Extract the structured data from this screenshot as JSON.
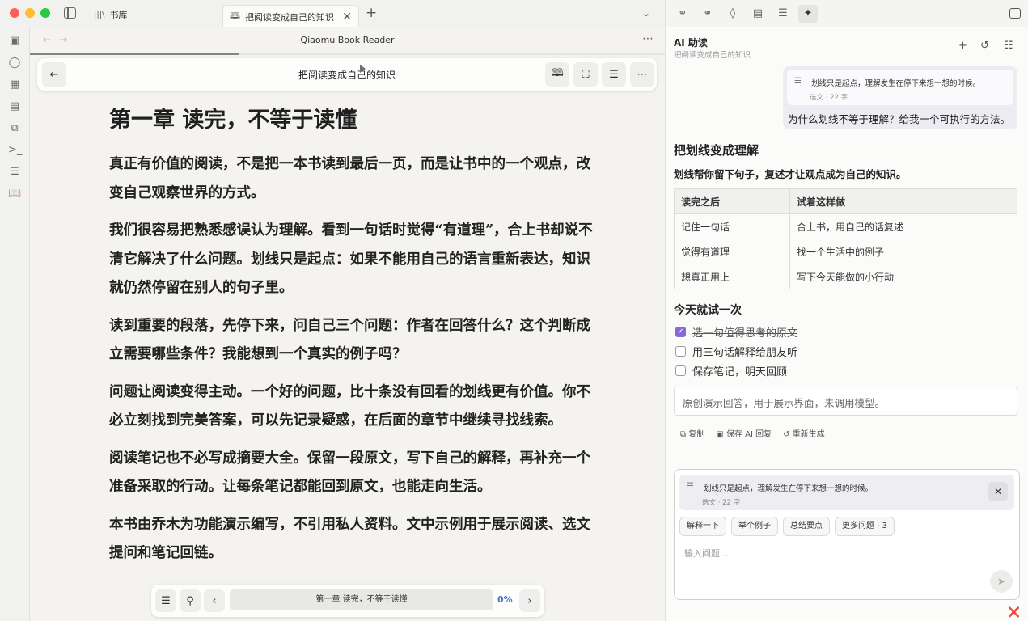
{
  "tabs": {
    "library": "书库",
    "book": "把阅读变成自己的知识"
  },
  "reader": {
    "header_title": "Qiaomu Book Reader",
    "toolbar_title": "把阅读变成自己的知识",
    "progress_fraction": 0.33,
    "chapter_title": "第一章 读完，不等于读懂",
    "paragraphs": [
      "真正有价值的阅读，不是把一本书读到最后一页，而是让书中的一个观点，改变自己观察世界的方式。",
      "我们很容易把熟悉感误认为理解。看到一句话时觉得“有道理”，合上书却说不清它解决了什么问题。划线只是起点：如果不能用自己的语言重新表达，知识就仍然停留在别人的句子里。",
      "读到重要的段落，先停下来，问自己三个问题：作者在回答什么？这个判断成立需要哪些条件？我能想到一个真实的例子吗？",
      "问题让阅读变得主动。一个好的问题，比十条没有回看的划线更有价值。你不必立刻找到完美答案，可以先记录疑惑，在后面的章节中继续寻找线索。",
      "阅读笔记也不必写成摘要大全。保留一段原文，写下自己的解释，再补充一个准备采取的行动。让每条笔记都能回到原文，也能走向生活。",
      "本书由乔木为功能演示编写，不引用私人资料。文中示例用于展示阅读、选文提问和笔记回链。"
    ],
    "bottom_chapter": "第一章 读完，不等于读懂",
    "progress_percent": "0%"
  },
  "ai": {
    "title": "AI 助读",
    "subtitle": "把阅读变成自己的知识",
    "quote_text": "划线只是起点，理解发生在停下来想一想的时候。",
    "quote_meta": "选文 · 22 字",
    "user_message": "为什么划线不等于理解？给我一个可执行的方法。",
    "answer_title": "把划线变成理解",
    "answer_lead": "划线帮你留下句子，复述才让观点成为自己的知识。",
    "table": {
      "headers": [
        "读完之后",
        "试着这样做"
      ],
      "rows": [
        [
          "记住一句话",
          "合上书，用自己的话复述"
        ],
        [
          "觉得有道理",
          "找一个生活中的例子"
        ],
        [
          "想真正用上",
          "写下今天能做的小行动"
        ]
      ]
    },
    "try_title": "今天就试一次",
    "checklist": [
      {
        "label": "选一句值得思考的原文",
        "checked": true
      },
      {
        "label": "用三句话解释给朋友听",
        "checked": false
      },
      {
        "label": "保存笔记，明天回顾",
        "checked": false
      }
    ],
    "note": "原创演示回答，用于展示界面，未调用模型。",
    "actions": {
      "copy": "复制",
      "save": "保存 AI 回复",
      "regenerate": "重新生成"
    },
    "input": {
      "quote_text": "划线只是起点，理解发生在停下来想一想的时候。",
      "quote_meta": "选文 · 22 字",
      "chips": [
        "解释一下",
        "举个例子",
        "总结要点",
        "更多问题 · 3"
      ],
      "placeholder": "输入问题..."
    }
  },
  "colors": {
    "accent": "#4a76c7",
    "check": "#8a6ad6",
    "progress": "#7d8a76"
  }
}
